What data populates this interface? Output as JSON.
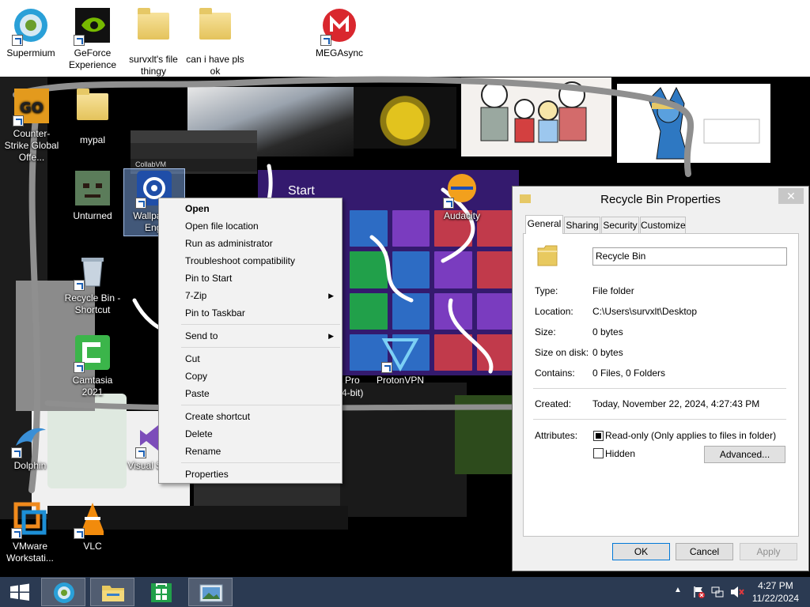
{
  "desktop": {
    "top_icons": [
      {
        "label": "Supermium",
        "icon": "supermium-icon"
      },
      {
        "label": "GeForce Experience",
        "icon": "geforce-icon"
      },
      {
        "label": "survxlt's file thingy",
        "icon": "folder-icon"
      },
      {
        "label": "can i have pls ok",
        "icon": "folder-icon"
      },
      {
        "label": "MEGAsync",
        "icon": "mega-icon"
      }
    ],
    "icons": [
      {
        "label": "Counter-Strike Global Offe...",
        "icon": "csgo-icon"
      },
      {
        "label": "mypal",
        "icon": "folder-icon"
      },
      {
        "label": "Unturned",
        "icon": "unturned-icon"
      },
      {
        "label": "Wallpaper Engi",
        "icon": "wallpaper-engine-icon"
      },
      {
        "label": "Recycle Bin - Shortcut",
        "icon": "recycle-bin-icon"
      },
      {
        "label": "Camtasia 2021",
        "icon": "camtasia-icon"
      },
      {
        "label": "Dolphin",
        "icon": "dolphin-icon"
      },
      {
        "label": "Visual S 202",
        "icon": "visual-studio-icon"
      },
      {
        "label": "VMware Workstati...",
        "icon": "vmware-icon"
      },
      {
        "label": "VLC",
        "icon": "vlc-icon"
      },
      {
        "label": "Audacity",
        "icon": "audacity-icon"
      },
      {
        "label": "ProtonVPN",
        "icon": "protonvpn-icon"
      }
    ],
    "collage_texts": {
      "start": "Start",
      "collabvm": "CollabVM",
      "pro": "Pro",
      "bit": "4-bit)"
    }
  },
  "context_menu": {
    "items": [
      {
        "label": "Open",
        "bold": true
      },
      {
        "label": "Open file location"
      },
      {
        "label": "Run as administrator"
      },
      {
        "label": "Troubleshoot compatibility"
      },
      {
        "label": "Pin to Start"
      },
      {
        "label": "7-Zip",
        "submenu": true
      },
      {
        "label": "Pin to Taskbar"
      },
      {
        "separator": true
      },
      {
        "label": "Send to",
        "submenu": true
      },
      {
        "separator": true
      },
      {
        "label": "Cut"
      },
      {
        "label": "Copy"
      },
      {
        "label": "Paste"
      },
      {
        "separator": true
      },
      {
        "label": "Create shortcut"
      },
      {
        "label": "Delete"
      },
      {
        "label": "Rename"
      },
      {
        "separator": true
      },
      {
        "label": "Properties"
      }
    ]
  },
  "dialog": {
    "title": "Recycle Bin Properties",
    "close": "✕",
    "tabs": [
      "General",
      "Sharing",
      "Security",
      "Customize"
    ],
    "active_tab": "General",
    "name_value": "Recycle Bin",
    "fields": [
      {
        "label": "Type:",
        "value": "File folder"
      },
      {
        "label": "Location:",
        "value": "C:\\Users\\survxlt\\Desktop"
      },
      {
        "label": "Size:",
        "value": "0 bytes"
      },
      {
        "label": "Size on disk:",
        "value": "0 bytes"
      },
      {
        "label": "Contains:",
        "value": "0 Files, 0 Folders"
      },
      {
        "label": "Created:",
        "value": "Today, November 22, 2024, 4:27:43 PM"
      }
    ],
    "attributes_label": "Attributes:",
    "readonly_label": "Read-only (Only applies to files in folder)",
    "hidden_label": "Hidden",
    "advanced_label": "Advanced...",
    "ok_label": "OK",
    "cancel_label": "Cancel",
    "apply_label": "Apply"
  },
  "taskbar": {
    "buttons": [
      "start-button",
      "supermium",
      "file-explorer",
      "store",
      "photos"
    ],
    "time": "4:27 PM",
    "date": "11/22/2024"
  },
  "colors": {
    "taskbar": "#2b3a52",
    "accent": "#0078d7",
    "folder": "#e6c866"
  }
}
